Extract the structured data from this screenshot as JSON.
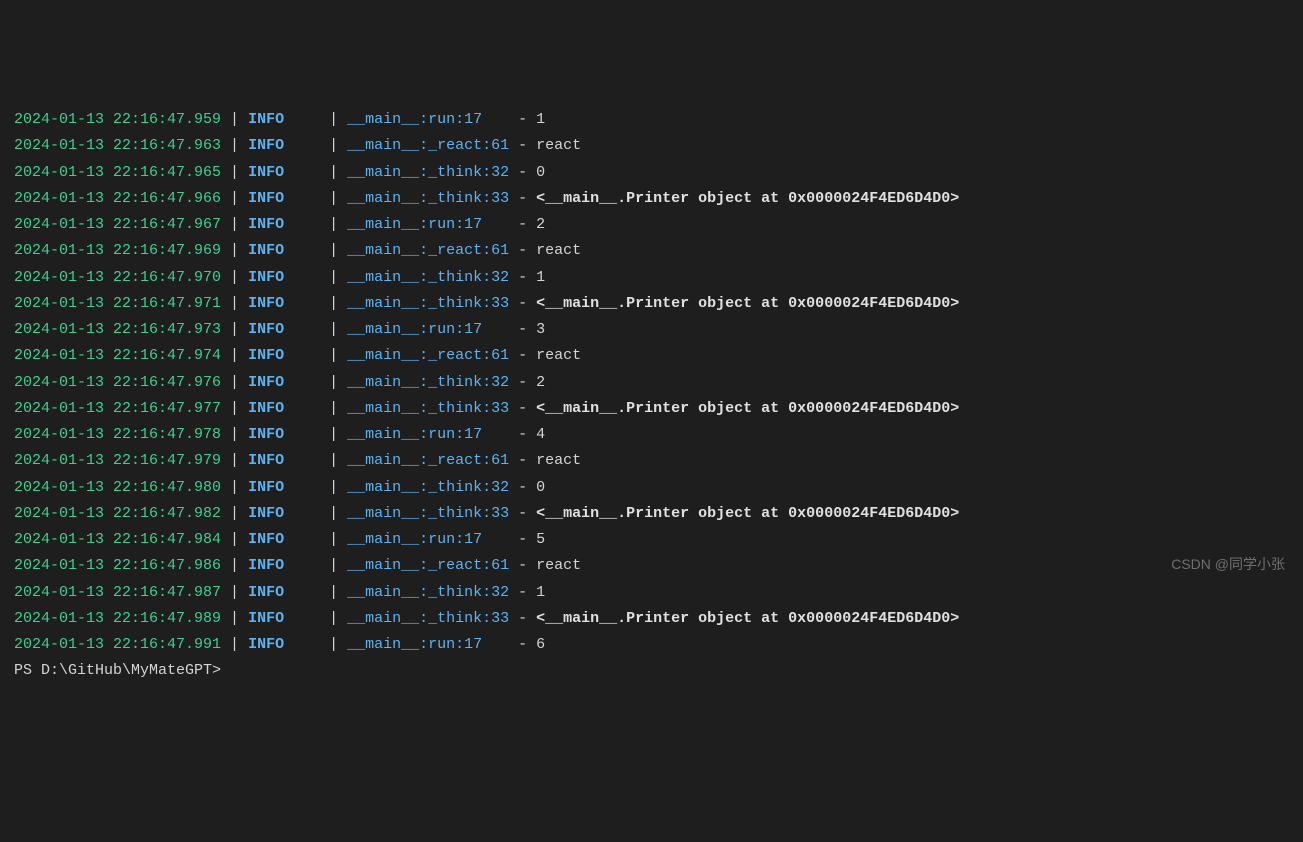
{
  "logs": [
    {
      "timestamp": "2024-01-13 22:16:47.959",
      "level": "INFO",
      "location": "__main__:run:17",
      "message": "1",
      "bold": false
    },
    {
      "timestamp": "2024-01-13 22:16:47.963",
      "level": "INFO",
      "location": "__main__:_react:61",
      "message": "react",
      "bold": false
    },
    {
      "timestamp": "2024-01-13 22:16:47.965",
      "level": "INFO",
      "location": "__main__:_think:32",
      "message": "0",
      "bold": false
    },
    {
      "timestamp": "2024-01-13 22:16:47.966",
      "level": "INFO",
      "location": "__main__:_think:33",
      "message": "<__main__.Printer object at 0x0000024F4ED6D4D0>",
      "bold": true
    },
    {
      "timestamp": "2024-01-13 22:16:47.967",
      "level": "INFO",
      "location": "__main__:run:17",
      "message": "2",
      "bold": false
    },
    {
      "timestamp": "2024-01-13 22:16:47.969",
      "level": "INFO",
      "location": "__main__:_react:61",
      "message": "react",
      "bold": false
    },
    {
      "timestamp": "2024-01-13 22:16:47.970",
      "level": "INFO",
      "location": "__main__:_think:32",
      "message": "1",
      "bold": false
    },
    {
      "timestamp": "2024-01-13 22:16:47.971",
      "level": "INFO",
      "location": "__main__:_think:33",
      "message": "<__main__.Printer object at 0x0000024F4ED6D4D0>",
      "bold": true
    },
    {
      "timestamp": "2024-01-13 22:16:47.973",
      "level": "INFO",
      "location": "__main__:run:17",
      "message": "3",
      "bold": false
    },
    {
      "timestamp": "2024-01-13 22:16:47.974",
      "level": "INFO",
      "location": "__main__:_react:61",
      "message": "react",
      "bold": false
    },
    {
      "timestamp": "2024-01-13 22:16:47.976",
      "level": "INFO",
      "location": "__main__:_think:32",
      "message": "2",
      "bold": false
    },
    {
      "timestamp": "2024-01-13 22:16:47.977",
      "level": "INFO",
      "location": "__main__:_think:33",
      "message": "<__main__.Printer object at 0x0000024F4ED6D4D0>",
      "bold": true
    },
    {
      "timestamp": "2024-01-13 22:16:47.978",
      "level": "INFO",
      "location": "__main__:run:17",
      "message": "4",
      "bold": false
    },
    {
      "timestamp": "2024-01-13 22:16:47.979",
      "level": "INFO",
      "location": "__main__:_react:61",
      "message": "react",
      "bold": false
    },
    {
      "timestamp": "2024-01-13 22:16:47.980",
      "level": "INFO",
      "location": "__main__:_think:32",
      "message": "0",
      "bold": false
    },
    {
      "timestamp": "2024-01-13 22:16:47.982",
      "level": "INFO",
      "location": "__main__:_think:33",
      "message": "<__main__.Printer object at 0x0000024F4ED6D4D0>",
      "bold": true
    },
    {
      "timestamp": "2024-01-13 22:16:47.984",
      "level": "INFO",
      "location": "__main__:run:17",
      "message": "5",
      "bold": false
    },
    {
      "timestamp": "2024-01-13 22:16:47.986",
      "level": "INFO",
      "location": "__main__:_react:61",
      "message": "react",
      "bold": false
    },
    {
      "timestamp": "2024-01-13 22:16:47.987",
      "level": "INFO",
      "location": "__main__:_think:32",
      "message": "1",
      "bold": false
    },
    {
      "timestamp": "2024-01-13 22:16:47.989",
      "level": "INFO",
      "location": "__main__:_think:33",
      "message": "<__main__.Printer object at 0x0000024F4ED6D4D0>",
      "bold": true
    },
    {
      "timestamp": "2024-01-13 22:16:47.991",
      "level": "INFO",
      "location": "__main__:run:17",
      "message": "6",
      "bold": false
    }
  ],
  "prompt": "PS D:\\GitHub\\MyMateGPT> ",
  "watermark": "CSDN @同学小张"
}
